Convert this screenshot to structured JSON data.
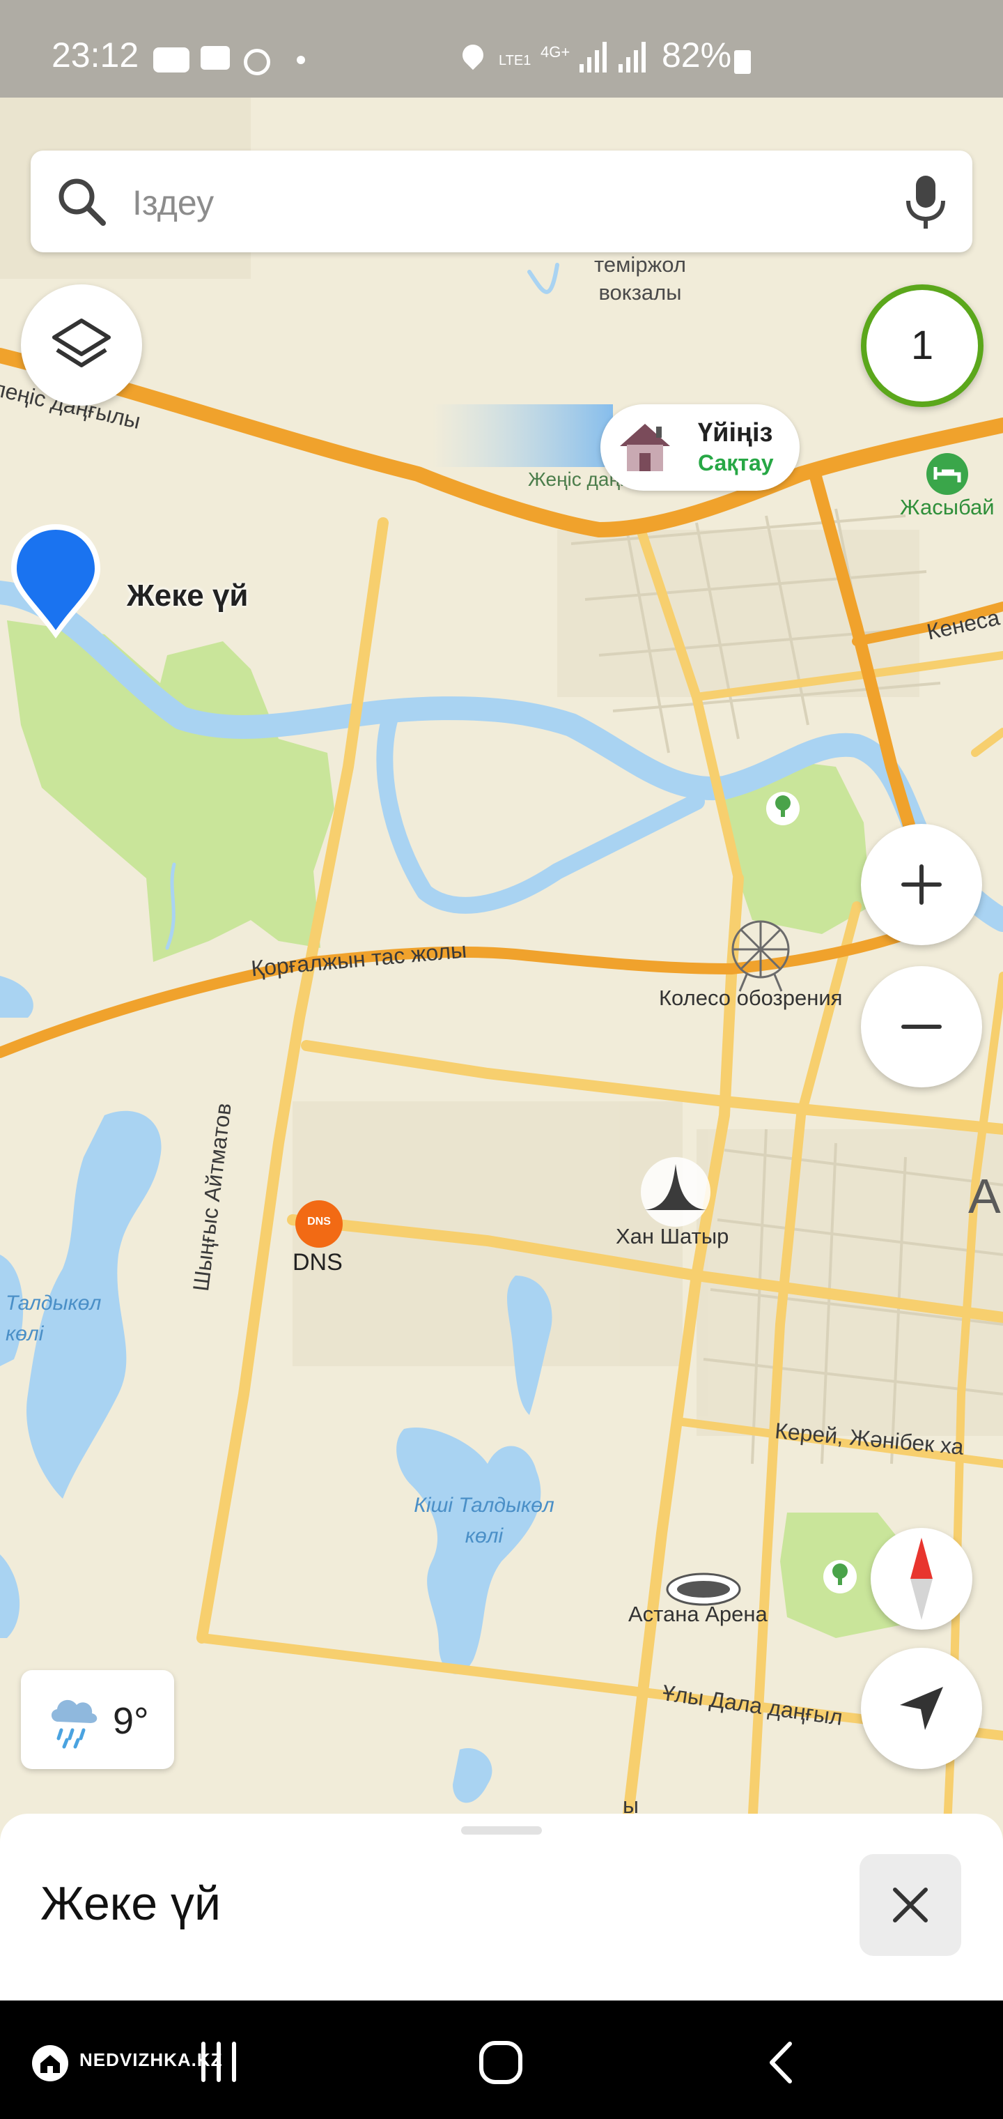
{
  "status_bar": {
    "time": "23:12",
    "battery": "82%",
    "network": "LTE1",
    "network2": "4G+",
    "icons": [
      "youtube-icon",
      "message-icon",
      "circle-icon",
      "dot-icon",
      "location-icon",
      "signal-icon",
      "battery-icon"
    ]
  },
  "search": {
    "placeholder": "Іздеу",
    "icons": [
      "search-icon",
      "microphone-icon"
    ]
  },
  "map": {
    "layers_icon": "layers-icon",
    "badge_count": "1",
    "home_button": {
      "title": "Үйіңіз",
      "action": "Сақтау"
    },
    "pin_label": "Жеке үй",
    "roads": {
      "top_left": "леңіс даңғылы",
      "zhenis": "Жеңіс даңғылы",
      "kenesary": "Кенеса",
      "korgalzhyn": "Қорғалжын тас жолы",
      "aitmatov": "Шыңғыс Айтматов",
      "kerey": "Керей, Жәнібек ха",
      "uly_dala": "Ұлы Дала даңғыл",
      "small": "ы"
    },
    "places": {
      "railway": "теміржол вокзалы",
      "railway_line1": "теміржол",
      "railway_line2": "вокзалы",
      "zhasybai": "Жасыбай",
      "ferris_wheel": "Колесо обозрения",
      "khan_shatyr": "Хан Шатыр",
      "dns": "DNS",
      "dns_logo": "DNS",
      "astana_arena": "Астана Арена",
      "city_letter": "А"
    },
    "water": {
      "taldykol_line1": "Талдыкөл",
      "taldykol_line2": "көлі",
      "kishi_line1": "Кіші Талдыкөл",
      "kishi_line2": "көлі"
    },
    "weather": {
      "temperature": "9°",
      "icon": "rain-cloud-icon"
    },
    "controls": [
      "zoom-in-icon",
      "zoom-out-icon",
      "compass-icon",
      "navigate-arrow-icon"
    ],
    "colors": {
      "land": "#f1ecd9",
      "park": "#c9e59a",
      "water": "#a9d3f2",
      "major_road": "#f0a22c",
      "road": "#f7cf6e",
      "pin": "#1a73f0",
      "save_green": "#27a745",
      "badge_ring": "#5ba71b"
    }
  },
  "bottom_sheet": {
    "title": "Жеке үй",
    "close_icon": "close-icon"
  },
  "nav_bar": {
    "brand": "NEDVIZHKA.KZ",
    "icons": [
      "home-logo-icon",
      "recent-apps-icon",
      "home-icon",
      "back-icon"
    ]
  }
}
